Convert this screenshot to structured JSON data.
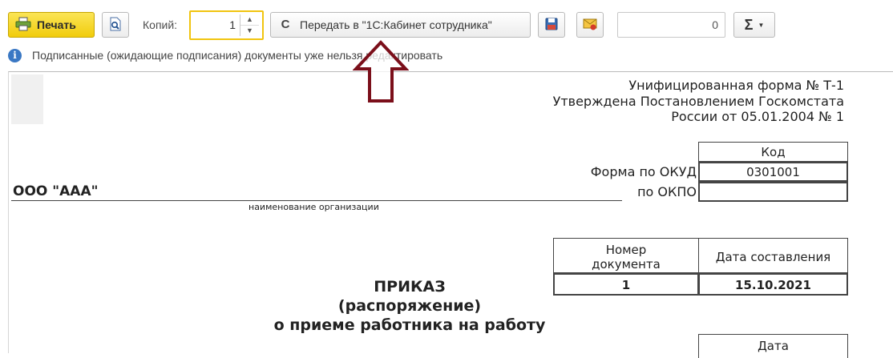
{
  "toolbar": {
    "print_label": "Печать",
    "copies_label": "Копий:",
    "copies_value": "1",
    "send_label": "Передать в \"1С:Кабинет сотрудника\"",
    "counter_value": "0",
    "sum_label": "Σ"
  },
  "icons": {
    "print": "printer-icon",
    "preview": "preview-icon",
    "save": "save-icon",
    "email": "email-icon",
    "sum": "sigma-icon"
  },
  "info": {
    "text": "Подписанные (ожидающие подписания) документы уже нельзя редактировать"
  },
  "document": {
    "header_lines": [
      "Унифицированная форма № Т-1",
      "Утверждена Постановлением Госкомстата",
      "России от 05.01.2004 № 1"
    ],
    "code_header": "Код",
    "okud_label": "Форма по ОКУД",
    "okud_value": "0301001",
    "okpo_label": "по ОКПО",
    "okpo_value": "",
    "org_name": "ООО \"ААА\"",
    "org_caption": "наименование организации",
    "doc_number_header": "Номер документа",
    "doc_date_header": "Дата составления",
    "doc_number": "1",
    "doc_date": "15.10.2021",
    "title_lines": [
      "ПРИКАЗ",
      "(распоряжение)",
      "о приеме работника на работу"
    ],
    "date_header": "Дата"
  },
  "colors": {
    "print_button": "#f1cc0c",
    "copies_border": "#f1c40f",
    "info_icon": "#3a78c4",
    "arrow": "#7b0f1a"
  }
}
